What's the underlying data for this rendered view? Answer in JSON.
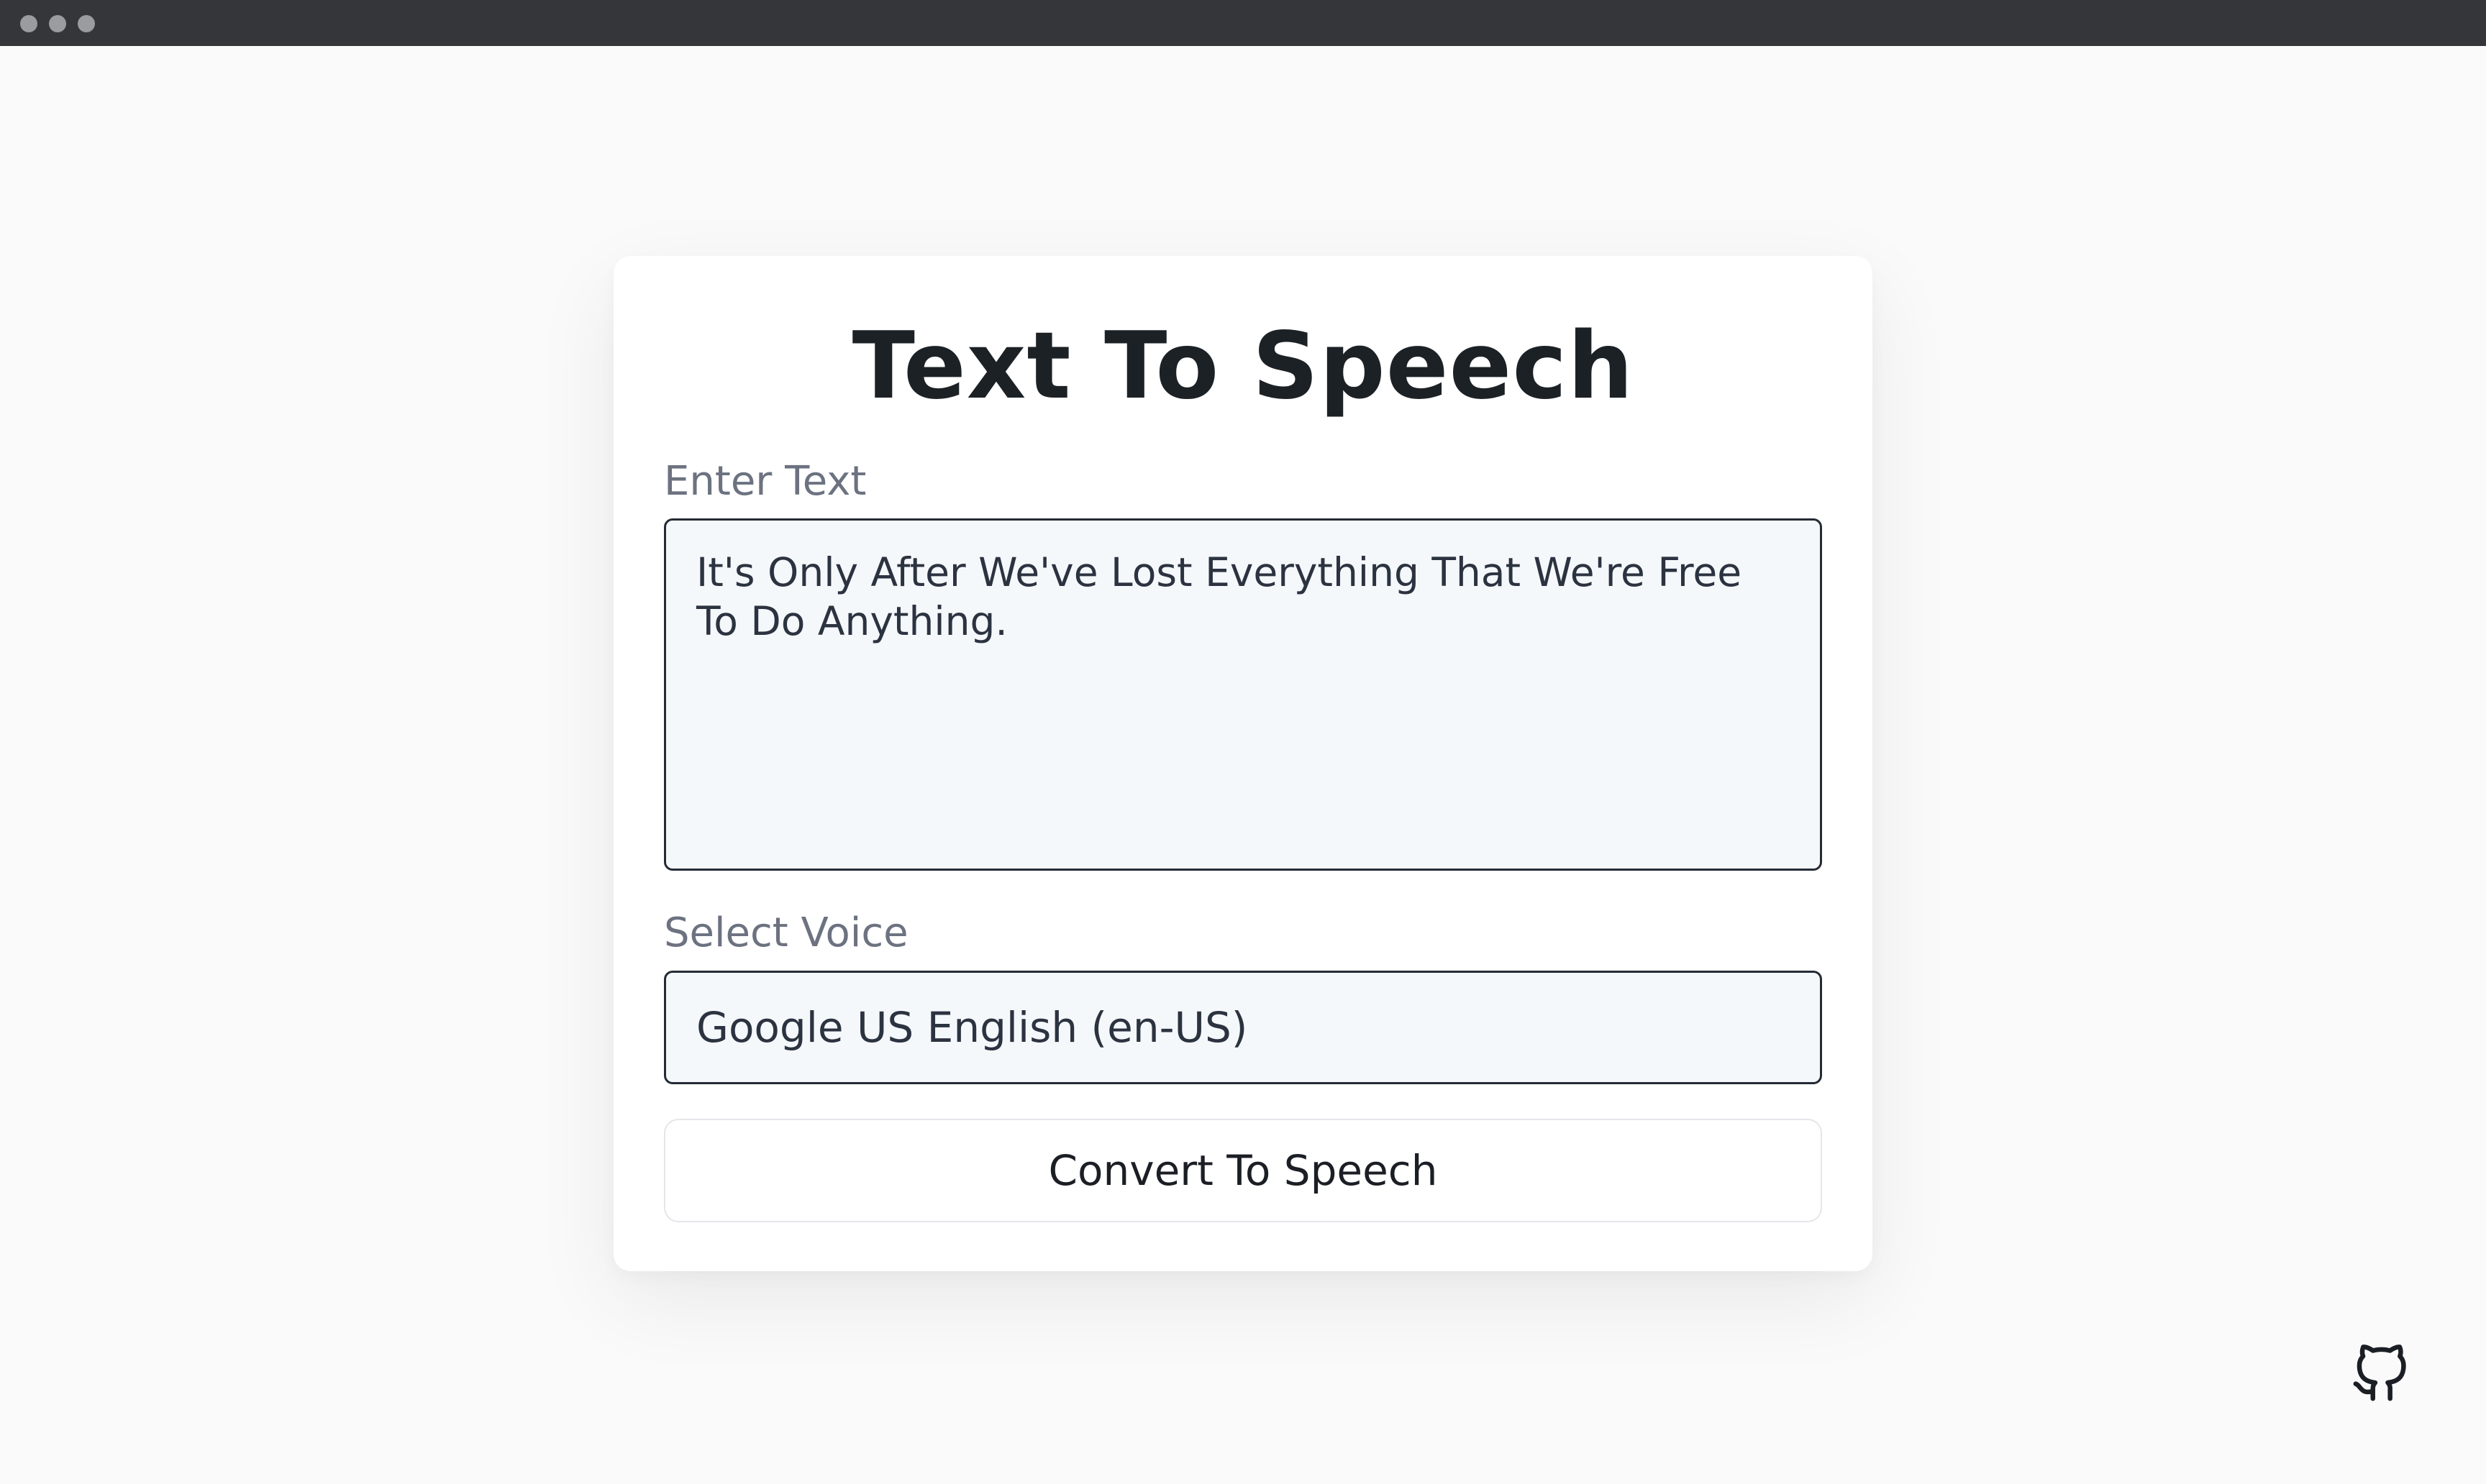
{
  "window": {
    "controls": [
      "close",
      "minimize",
      "maximize"
    ]
  },
  "app": {
    "title": "Text To Speech"
  },
  "text_input": {
    "label": "Enter Text",
    "value": "It's Only After We've Lost Everything That We're Free To Do Anything."
  },
  "voice_select": {
    "label": "Select Voice",
    "selected": "Google US English (en-US)"
  },
  "convert_button": {
    "label": "Convert To Speech"
  },
  "footer": {
    "github_icon": "github-icon"
  },
  "colors": {
    "background": "#fafafa",
    "card": "#ffffff",
    "title": "#1c2126",
    "label": "#6c7280",
    "field_bg": "#f5f8fb",
    "field_border": "#242b36",
    "titlebar": "#35363a"
  }
}
